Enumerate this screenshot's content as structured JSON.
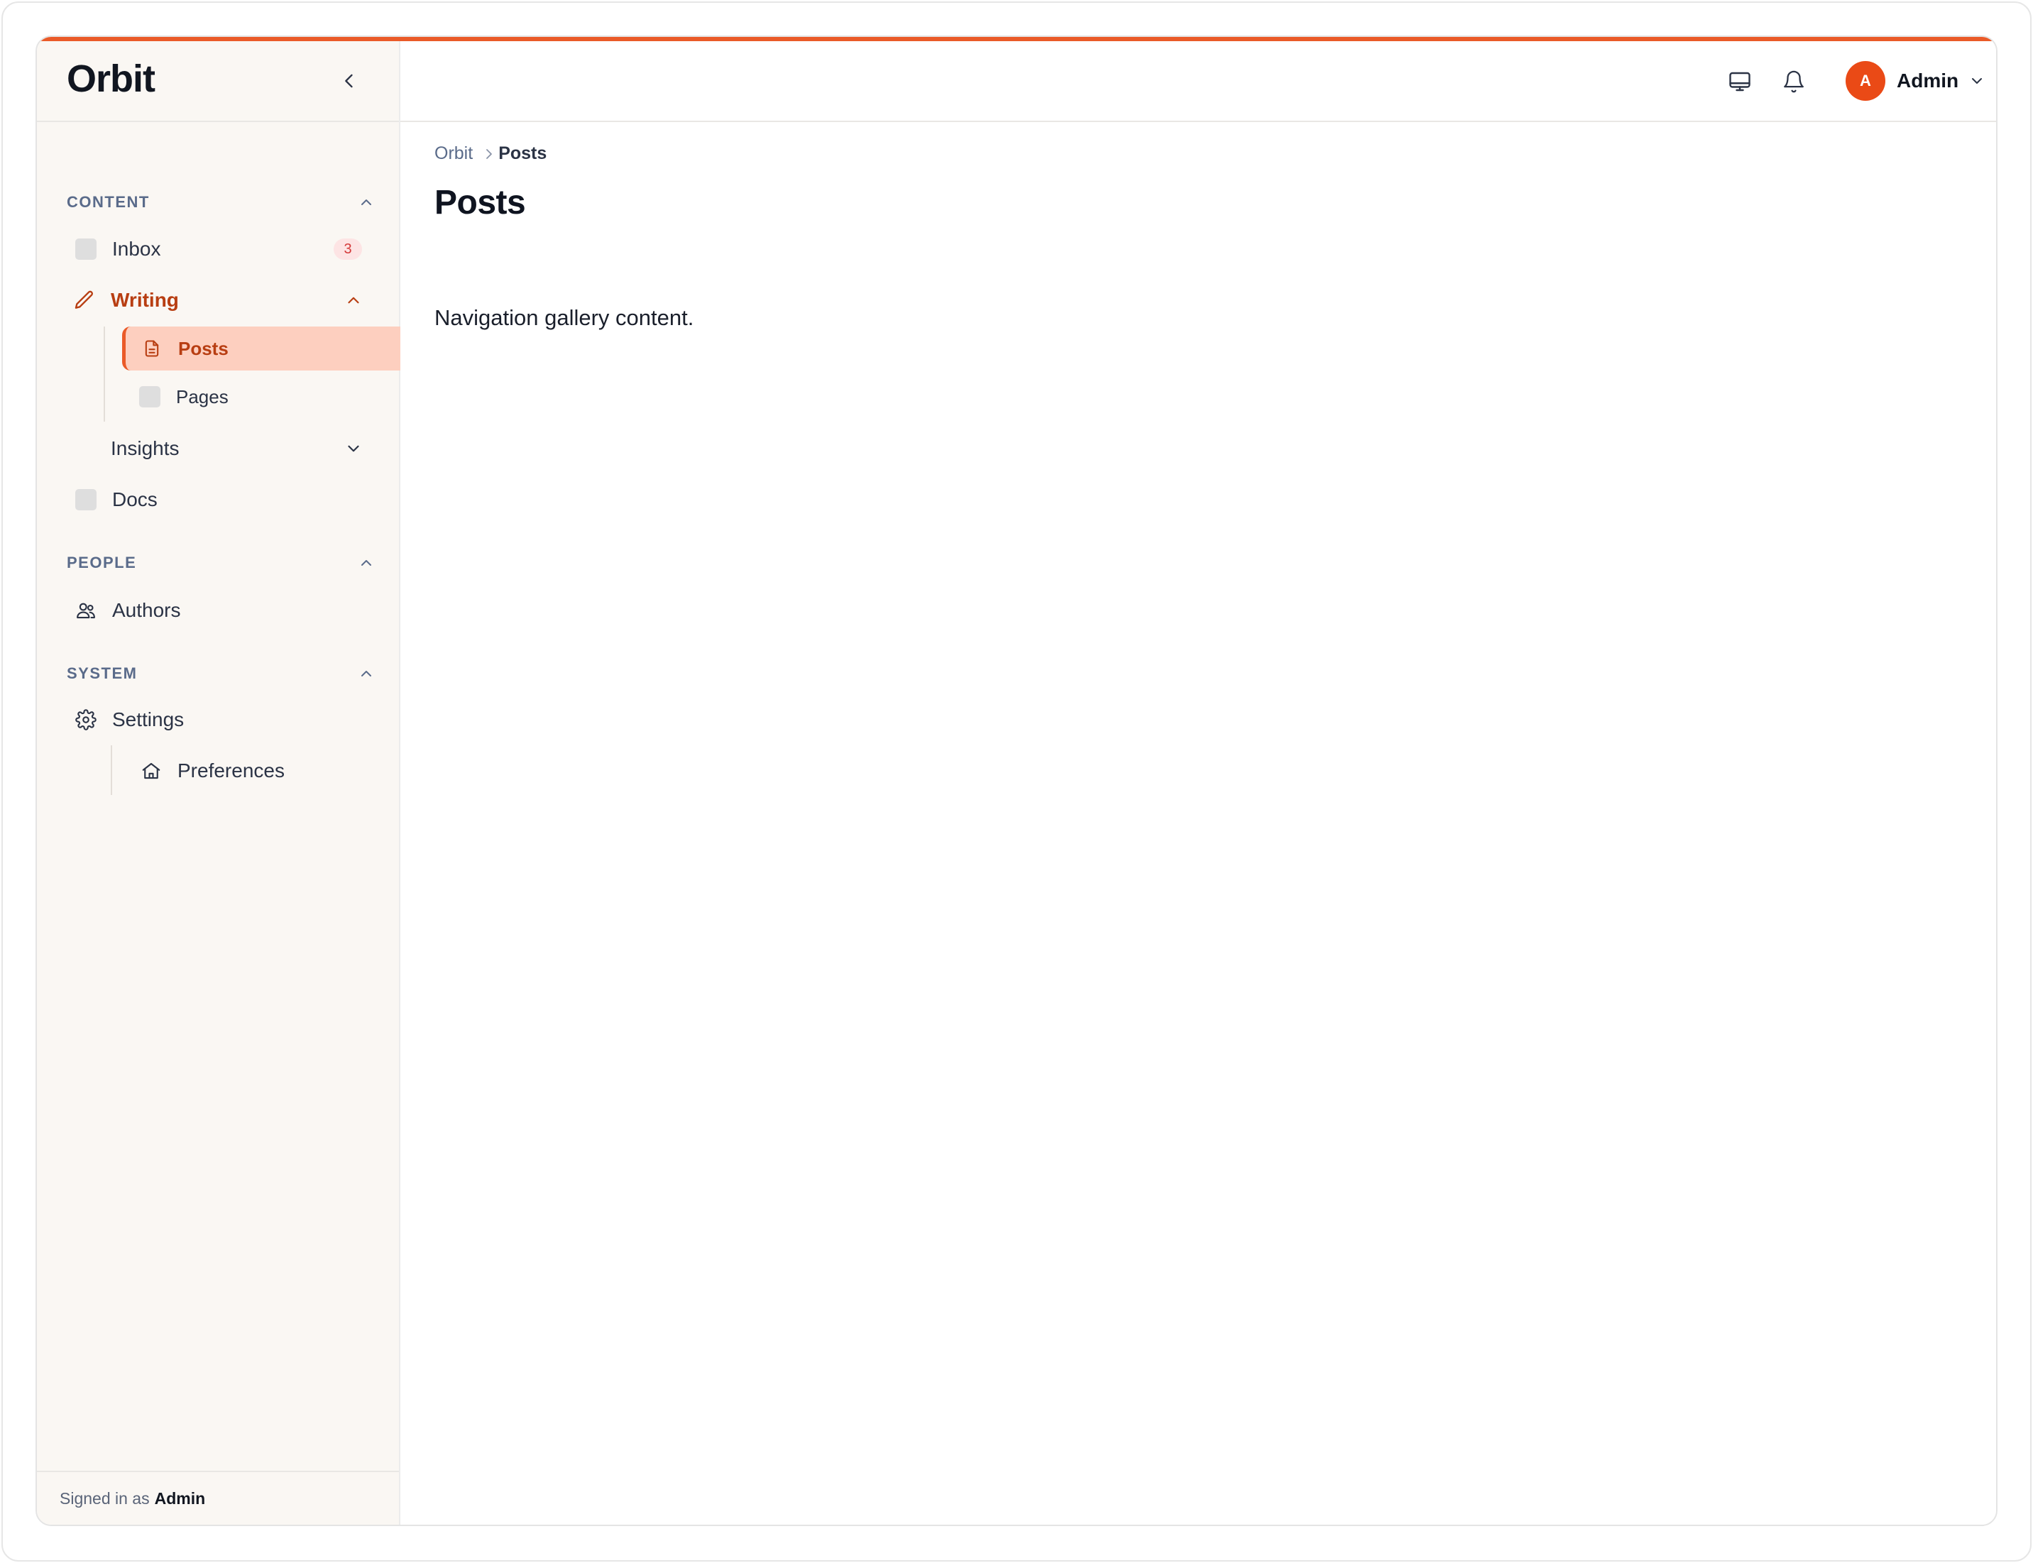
{
  "app": {
    "brand": "Orbit",
    "accent_color": "#ea5a28"
  },
  "sidebar": {
    "collapse_icon": "chevron-left-icon",
    "sections": [
      {
        "title": "CONTENT",
        "expanded": true,
        "items": [
          {
            "label": "Inbox",
            "icon": "placeholder-square-icon",
            "badge": "3"
          },
          {
            "label": "Writing",
            "icon": "pencil-icon",
            "expanded": true,
            "active": true,
            "children": [
              {
                "label": "Posts",
                "icon": "document-icon",
                "selected": true
              },
              {
                "label": "Pages",
                "icon": "placeholder-square-icon"
              }
            ]
          },
          {
            "label": "Insights",
            "expanded": false
          },
          {
            "label": "Docs",
            "icon": "placeholder-square-icon"
          }
        ]
      },
      {
        "title": "PEOPLE",
        "expanded": true,
        "items": [
          {
            "label": "Authors",
            "icon": "users-icon"
          }
        ]
      },
      {
        "title": "SYSTEM",
        "expanded": true,
        "items": [
          {
            "label": "Settings",
            "icon": "gear-icon",
            "children": [
              {
                "label": "Preferences",
                "icon": "home-icon"
              }
            ]
          }
        ]
      }
    ],
    "footer": {
      "prefix": "Signed in as",
      "user": "Admin"
    }
  },
  "topbar": {
    "icons": [
      "monitor-icon",
      "bell-icon"
    ],
    "user": {
      "initial": "A",
      "name": "Admin",
      "avatar_color": "#ea4a16"
    }
  },
  "main": {
    "breadcrumb": {
      "root": "Orbit",
      "current": "Posts"
    },
    "title": "Posts",
    "body": "Navigation gallery content."
  }
}
